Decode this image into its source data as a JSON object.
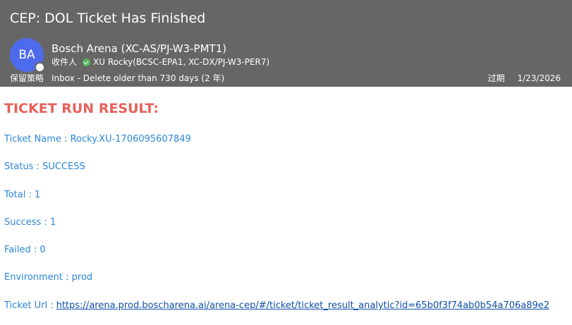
{
  "email": {
    "subject": "CEP: DOL Ticket Has Finished",
    "sender": {
      "initials": "BA",
      "name": "Bosch Arena (XC-AS/PJ-W3-PMT1)",
      "avatar_color": "#4f6bed"
    },
    "recipient": {
      "label": "收件人",
      "name": "XU Rocky(BCSC-EPA1, XC-DX/PJ-W3-PER7)",
      "verified_icon": "check-circle-icon"
    },
    "retention": {
      "label": "保留策略",
      "policy": "Inbox - Delete older than 730 days (2 年)"
    },
    "expiry": {
      "label": "过期",
      "date": "1/23/2026"
    }
  },
  "result": {
    "title": "TICKET RUN RESULT:",
    "ticket_name": "Ticket Name : Rocky.XU-1706095607849",
    "status": "Status : SUCCESS",
    "total": "Total : 1",
    "success": "Success : 1",
    "failed": "Failed : 0",
    "environment": "Environment : prod",
    "url_label": "Ticket Url : ",
    "url": "https://arena.prod.boscharena.ai/arena-cep/#/ticket/ticket_result_analytic?id=65b0f3f74ab0b54a706a89e2"
  },
  "colors": {
    "header_bg": "#666666",
    "title_red": "#e8605a",
    "field_blue": "#2b86d8",
    "link_blue": "#0f4fa8"
  }
}
